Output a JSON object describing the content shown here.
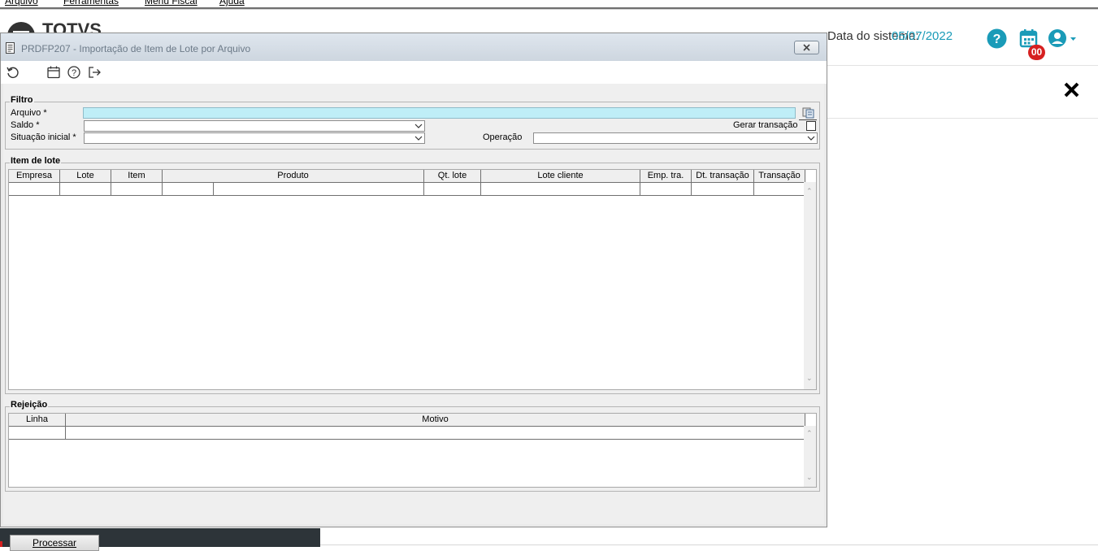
{
  "app": {
    "menu": [
      "Arquivo",
      "Ferramentas",
      "Menu Fiscal",
      "Ajuda"
    ],
    "logo_text": "TOTVS",
    "date_label": "Data do sistema:",
    "date_value": "05/07/2022",
    "calendar_badge": "00",
    "colors": {
      "accent": "#1a9bb8",
      "badge": "#d62020",
      "dark_strip": "#2d3439"
    }
  },
  "dialog": {
    "title": "PRDFP207 - Importação de Item de Lote por Arquivo",
    "toolbar_icons": [
      "refresh-icon",
      "calendar-icon",
      "help-icon",
      "exit-icon"
    ],
    "filter": {
      "group_label": "Filtro",
      "arquivo_label": "Arquivo *",
      "arquivo_value": "",
      "saldo_label": "Saldo *",
      "saldo_value": "",
      "situacao_label": "Situação inicial *",
      "situacao_value": "",
      "gerar_label": "Gerar transação",
      "gerar_checked": false,
      "operacao_label": "Operação",
      "operacao_value": ""
    },
    "item_lote": {
      "group_label": "Item de lote",
      "columns": [
        "Empresa",
        "Lote",
        "Item",
        "Produto",
        "Qt. lote",
        "Lote cliente",
        "Emp. tra.",
        "Dt. transação",
        "Transação"
      ]
    },
    "rejeicao": {
      "group_label": "Rejeição",
      "columns": [
        "Linha",
        "Motivo"
      ]
    },
    "process_button": "Processar"
  }
}
